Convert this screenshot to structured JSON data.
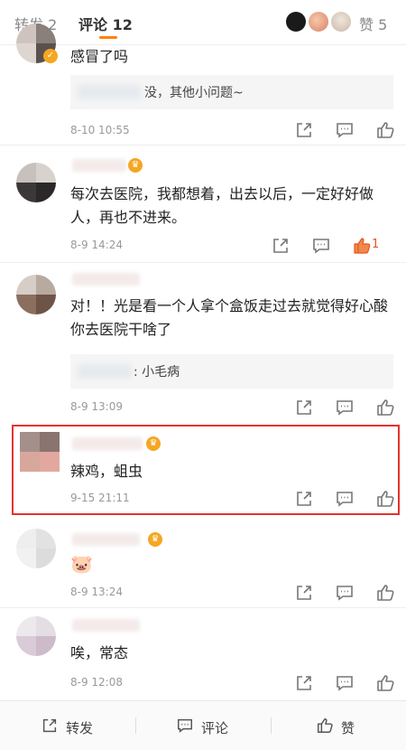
{
  "tabs": {
    "repost_label": "转发 2",
    "comment_label": "评论 12",
    "like_label": "赞 5"
  },
  "comments": [
    {
      "text": "感冒了吗",
      "reply_text": "没，其他小问题~",
      "time": "8-10 10:55",
      "like_count": ""
    },
    {
      "text": "每次去医院，我都想着，出去以后，一定好好做人，再也不进来。",
      "time": "8-9 14:24",
      "like_count": "1"
    },
    {
      "text": "对！！光是看一个人拿个盒饭走过去就觉得好心酸 你去医院干啥了",
      "reply_text": ": 小毛病",
      "time": "8-9 13:09",
      "like_count": ""
    },
    {
      "text": "辣鸡，蛆虫",
      "time": "9-15 21:11",
      "like_count": ""
    },
    {
      "emoji": "🐷",
      "time": "8-9 13:24",
      "like_count": ""
    },
    {
      "text": "唉，常态",
      "time": "8-9 12:08",
      "like_count": ""
    }
  ],
  "bottom_bar": {
    "repost_label": "转发",
    "comment_label": "评论",
    "like_label": "赞"
  },
  "colors": {
    "accent_orange": "#ff8200",
    "highlight_red": "#e5322d",
    "liked_orange": "#e8541e"
  }
}
